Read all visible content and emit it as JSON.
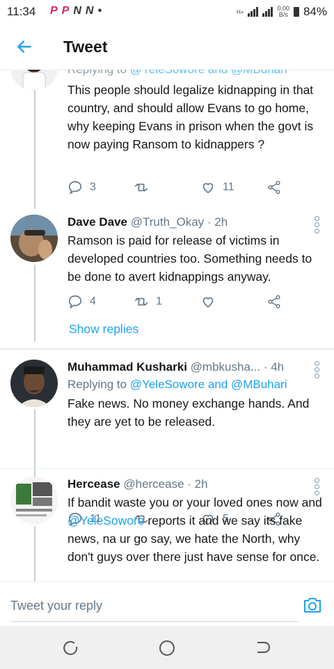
{
  "status_bar": {
    "time": "11:34",
    "app_icons": [
      "P",
      "P",
      "N",
      "N",
      "•"
    ],
    "network_type": "H+",
    "net_speed_value": "0.00",
    "net_speed_unit": "B/s",
    "battery": "84%"
  },
  "header": {
    "title": "Tweet"
  },
  "tweets": [
    {
      "reply_to_prefix": "Replying to",
      "reply_to_handles": "@YeleSowore and @MBuhari",
      "text": "This people should legalize kidnapping in that country, and should allow Evans to go home, why keeping Evans in prison when the govt is now paying Ransom to kidnappers ?",
      "replies": "3",
      "retweets": "",
      "likes": "11"
    },
    {
      "name": "Dave Dave",
      "handle": "@Truth_Okay",
      "time": "· 2h",
      "text": "Ramson is paid for release of victims  in developed countries too. Something needs to be done to avert kidnappings anyway.",
      "replies": "4",
      "retweets": "1",
      "likes": "",
      "show_replies": "Show replies"
    },
    {
      "name": "Muhammad Kusharki",
      "handle": "@mbkusha...",
      "time": "· 4h",
      "reply_to_prefix": "Replying to",
      "reply_to_handles": "@YeleSowore and @MBuhari",
      "text": "Fake news. No money exchange hands. And they are yet to be released.",
      "replies": "11",
      "retweets": "",
      "likes": "5"
    },
    {
      "name": "Hercease",
      "handle": "@hercease",
      "time": "· 2h",
      "text_before": "If bandit waste you or your loved ones now and",
      "mention": "@YeleSowore",
      "text_after": "reports it and we say its fake news, na ur go say, we hate the North, why don't guys over there just have sense for once."
    }
  ],
  "composer": {
    "placeholder": "Tweet your reply"
  },
  "colors": {
    "accent": "#1da1f2",
    "secondary_text": "#657786",
    "primary_text": "#14171a"
  }
}
